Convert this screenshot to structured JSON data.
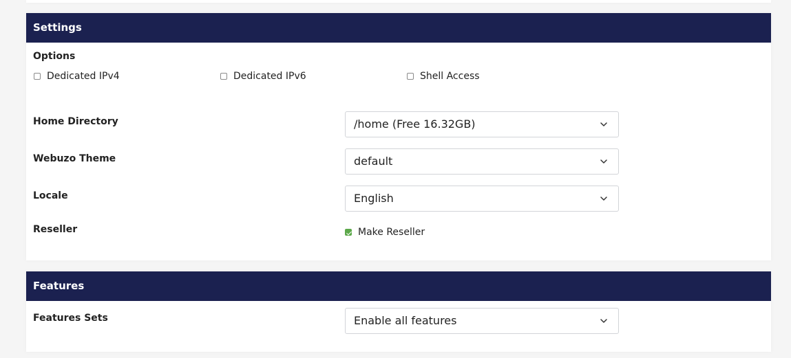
{
  "settings": {
    "header": "Settings",
    "options_label": "Options",
    "options": [
      {
        "label": "Dedicated IPv4",
        "checked": false
      },
      {
        "label": "Dedicated IPv6",
        "checked": false
      },
      {
        "label": "Shell Access",
        "checked": false
      }
    ],
    "home_directory": {
      "label": "Home Directory",
      "value": "/home (Free 16.32GB)"
    },
    "theme": {
      "label": "Webuzo Theme",
      "value": "default"
    },
    "locale": {
      "label": "Locale",
      "value": "English"
    },
    "reseller": {
      "label": "Reseller",
      "checkbox_label": "Make Reseller",
      "checked": true
    }
  },
  "features": {
    "header": "Features",
    "sets": {
      "label": "Features Sets",
      "value": "Enable all features"
    }
  },
  "colors": {
    "header_bg": "#1b2150",
    "checkbox_checked": "#5ca84a"
  },
  "icons": {
    "dropdown": "chevron-down-icon"
  }
}
